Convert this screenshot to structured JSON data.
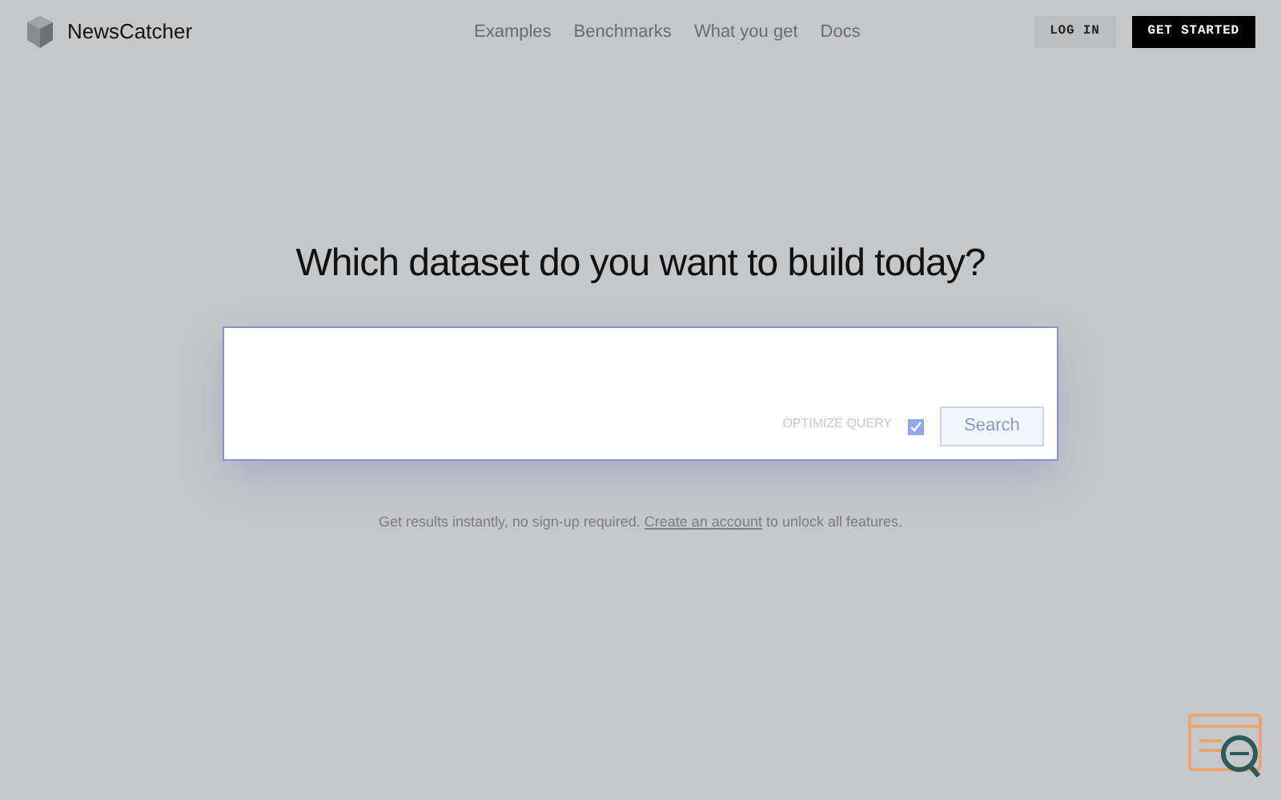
{
  "brand": "NewsCatcher",
  "nav": [
    {
      "label": "Examples"
    },
    {
      "label": "Benchmarks"
    },
    {
      "label": "What you get"
    },
    {
      "label": "Docs"
    }
  ],
  "login": "LOG IN",
  "cta": "GET STARTED",
  "heading": "Which dataset do you want to build today?",
  "search": {
    "optimize_label": "OPTIMIZE QUERY",
    "optimize_checked": true,
    "button": "Search"
  },
  "note": {
    "before": "Get results instantly, no sign-up required.",
    "link": "Create an account",
    "after": "to unlock all features."
  }
}
